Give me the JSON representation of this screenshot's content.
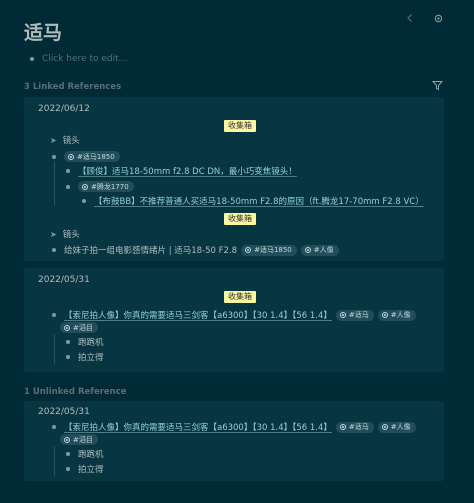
{
  "page": {
    "title": "适马",
    "placeholder": "Click here to edit..."
  },
  "linked": {
    "header": "3 Linked References",
    "cards": [
      {
        "date": "2022/06/12",
        "badge1": "收集箱",
        "parent1": "镜头",
        "tag_1850": "#适马1850",
        "item1": "【顾俊】适马18-50mm f2.8 DC DN，最小巧变焦镜头！",
        "tag_tenglong": "#腾龙1770",
        "item2": "【布鼓BB】不推荐普通人买适马18-50mm F2.8的原因（ft.腾龙17-70mm F2.8 VC）",
        "badge2": "收集箱",
        "parent2": "镜头",
        "item3": "给妹子拍一组电影感情绪片 | 适马18-50 F2.8",
        "tag_1850b": "#适马1850",
        "tag_portrait": "#人像"
      },
      {
        "date": "2022/05/31",
        "badge": "收集箱",
        "item": "【索尼拍人像】你真的需要适马三剑客【a6300】【30 1.4】【56 1.4】",
        "tag_sigma": "#适马",
        "tag_portrait": "#人像",
        "tag_inbox": "#滔目",
        "sub1": "跑跑机",
        "sub2": "拍立得"
      }
    ]
  },
  "unlinked": {
    "header": "1 Unlinked Reference",
    "card": {
      "date": "2022/05/31",
      "item": "【索尼拍人像】你真的需要适马三剑客【a6300】【30 1.4】【56 1.4】",
      "tag_sigma": "#适马",
      "tag_portrait": "#人像",
      "tag_inbox": "#滔目",
      "sub1": "跑跑机",
      "sub2": "拍立得"
    }
  },
  "icons": {
    "back": "chevron-left-icon",
    "settings": "gear-icon",
    "filter": "filter-icon",
    "tag": "tag-icon"
  },
  "colors": {
    "background": "#002b36",
    "card": "#073642",
    "badge": "#fdf6a3",
    "tag": "#214e5c",
    "link": "#93d0d8"
  }
}
